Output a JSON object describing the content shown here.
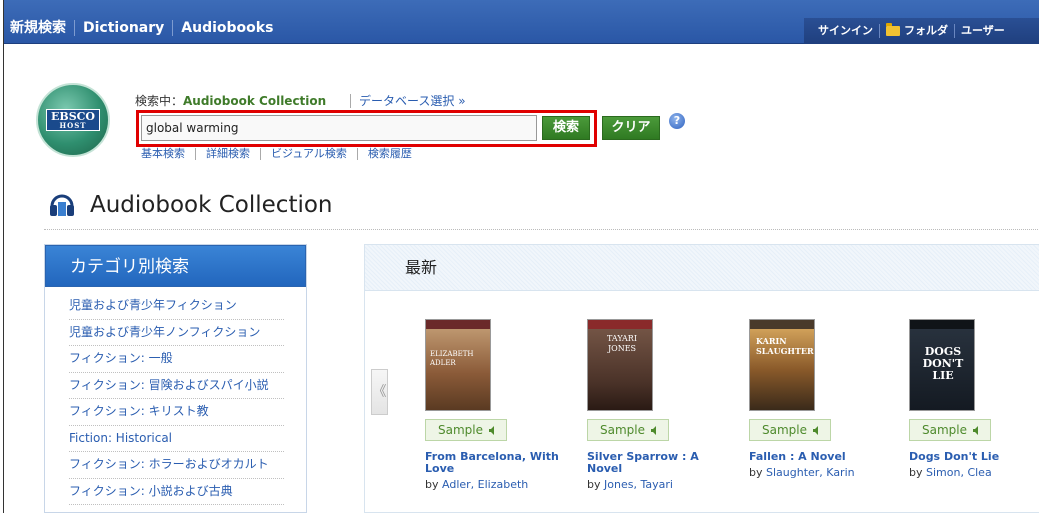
{
  "topnav": {
    "items": [
      "新規検索",
      "Dictionary",
      "Audiobooks"
    ],
    "user_items": [
      "サインイン",
      "フォルダ",
      "ユーザー"
    ]
  },
  "logo": {
    "line1": "EBSCO",
    "line2": "HOST"
  },
  "search": {
    "searching_label": "検索中：",
    "database": "Audiobook Collection",
    "db_select": "データベース選択 »",
    "query": "global warming",
    "search_button": "検索",
    "clear_button": "クリア",
    "help": "?",
    "links": [
      "基本検索",
      "詳細検索",
      "ビジュアル検索",
      "検索履歴"
    ]
  },
  "collection": {
    "title": "Audiobook Collection"
  },
  "sidebar": {
    "header": "カテゴリ別検索",
    "categories": [
      "児童および青少年フィクション",
      "児童および青少年ノンフィクション",
      "フィクション: 一般",
      "フィクション: 冒険およびスパイ小説",
      "フィクション: キリスト教",
      "Fiction: Historical",
      "フィクション: ホラーおよびオカルト",
      "フィクション: 小説および古典"
    ]
  },
  "latest": {
    "header": "最新",
    "prev": "《",
    "sample_label": "Sample",
    "by": "by",
    "books": [
      {
        "title": "From Barcelona, With Love",
        "author": "Adler, Elizabeth",
        "cover_color": "#8a5a38",
        "cover_text": "ELIZABETH ADLER"
      },
      {
        "title": "Silver Sparrow : A Novel",
        "author": "Jones, Tayari",
        "cover_color": "#5a3c2c",
        "cover_text": "TAYARI JONES"
      },
      {
        "title": "Fallen : A Novel",
        "author": "Slaughter, Karin",
        "cover_color": "#6b4a2a",
        "cover_text": "KARIN SLAUGHTER"
      },
      {
        "title": "Dogs Don't Lie",
        "author": "Simon, Clea",
        "cover_color": "#1e2630",
        "cover_text": "DOGS DON'T LIE"
      }
    ]
  },
  "colors": {
    "topbar": "#2a57a6",
    "accent_green": "#2f7a22",
    "link_blue": "#2a5db0",
    "highlight_red": "#e00000"
  }
}
